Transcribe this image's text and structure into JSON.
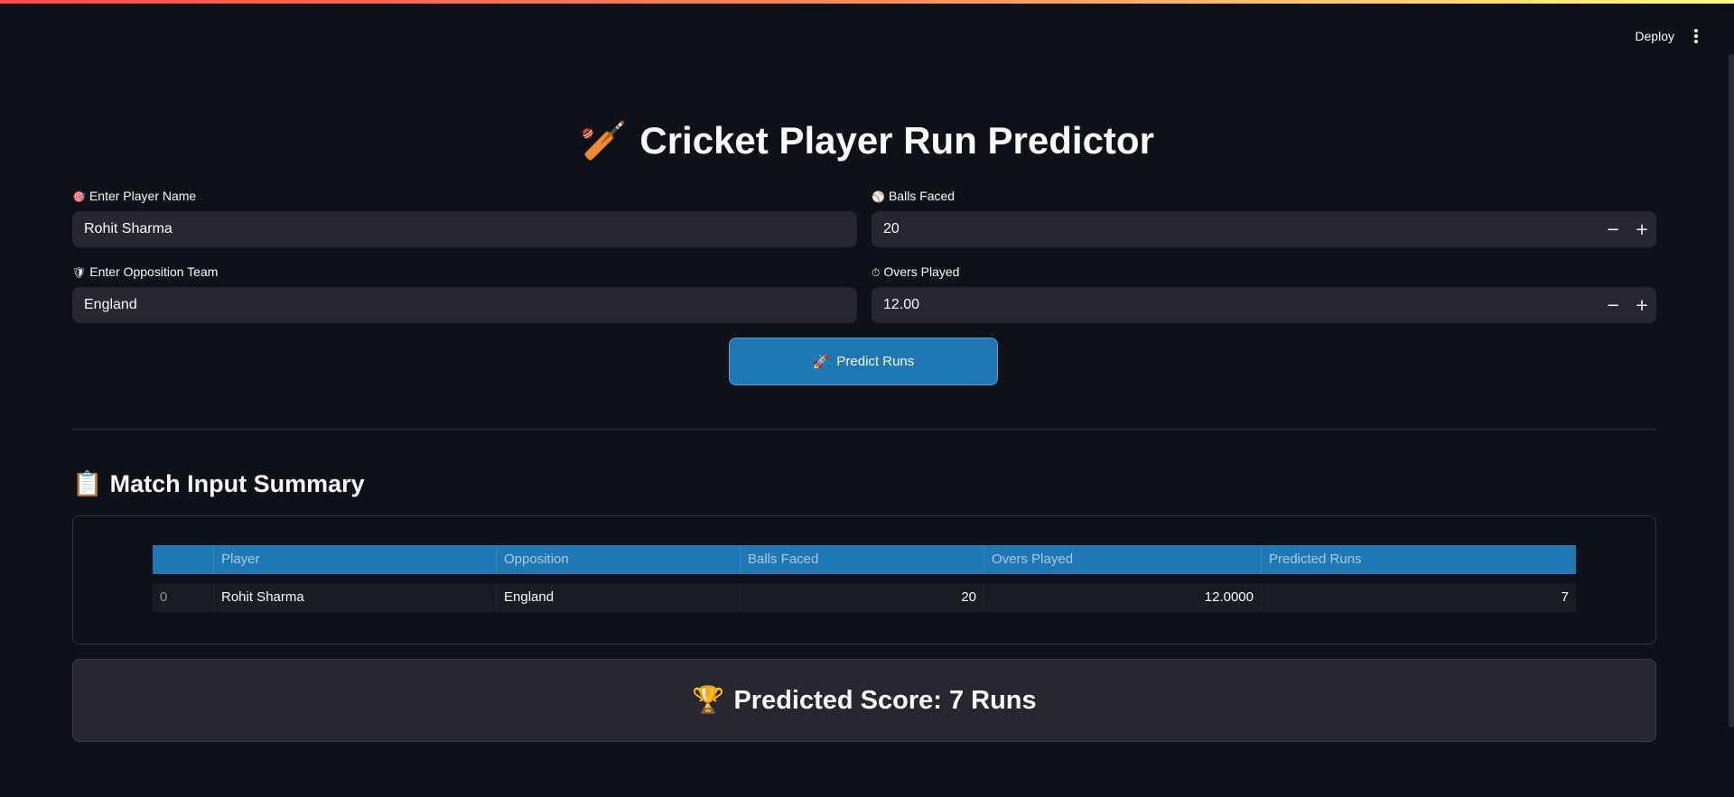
{
  "header": {
    "deploy_label": "Deploy",
    "menu_icon": "kebab-menu-icon"
  },
  "title": {
    "emoji": "🏏",
    "text": "Cricket Player Run Predictor"
  },
  "form": {
    "player_name": {
      "emoji": "🎯",
      "label": "Enter Player Name",
      "value": "Rohit Sharma"
    },
    "balls_faced": {
      "emoji": "⚾",
      "label": "Balls Faced",
      "value": "20",
      "minus": "−",
      "plus": "+"
    },
    "opposition_team": {
      "emoji": "🛡",
      "label": "Enter Opposition Team",
      "value": "England"
    },
    "overs_played": {
      "emoji": "⏱",
      "label": "Overs Played",
      "value": "12.00",
      "minus": "−",
      "plus": "+"
    }
  },
  "predict_button": {
    "emoji": "🚀",
    "label": "Predict Runs"
  },
  "summary": {
    "emoji": "📋",
    "title": "Match Input Summary",
    "columns": [
      "",
      "Player",
      "Opposition",
      "Balls Faced",
      "Overs Played",
      "Predicted Runs"
    ],
    "rows": [
      [
        "0",
        "Rohit Sharma",
        "England",
        "20",
        "12.0000",
        "7"
      ]
    ]
  },
  "result": {
    "emoji": "🏆",
    "text": "Predicted Score: 7 Runs"
  },
  "colors": {
    "background": "#0e1117",
    "input_bg": "#262730",
    "accent": "#1f77b4"
  }
}
